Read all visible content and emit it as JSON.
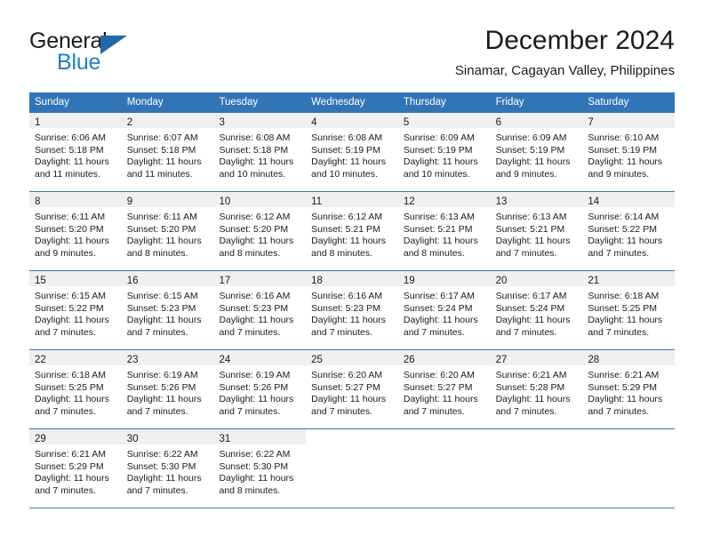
{
  "brand": {
    "name_part1": "General",
    "name_part2": "Blue",
    "triangle_icon": "triangle-logo-icon",
    "accent_color": "#1d7ec8",
    "logo_color": "#2469a8"
  },
  "header": {
    "title": "December 2024",
    "subtitle": "Sinamar, Cagayan Valley, Philippines"
  },
  "calendar": {
    "header_bg_color": "#3275b6",
    "daynum_band_color": "#f0f0f0",
    "weekdays": [
      "Sunday",
      "Monday",
      "Tuesday",
      "Wednesday",
      "Thursday",
      "Friday",
      "Saturday"
    ],
    "weeks": [
      [
        {
          "day": "1",
          "sunrise": "Sunrise: 6:06 AM",
          "sunset": "Sunset: 5:18 PM",
          "daylight_line1": "Daylight: 11 hours",
          "daylight_line2": "and 11 minutes."
        },
        {
          "day": "2",
          "sunrise": "Sunrise: 6:07 AM",
          "sunset": "Sunset: 5:18 PM",
          "daylight_line1": "Daylight: 11 hours",
          "daylight_line2": "and 11 minutes."
        },
        {
          "day": "3",
          "sunrise": "Sunrise: 6:08 AM",
          "sunset": "Sunset: 5:18 PM",
          "daylight_line1": "Daylight: 11 hours",
          "daylight_line2": "and 10 minutes."
        },
        {
          "day": "4",
          "sunrise": "Sunrise: 6:08 AM",
          "sunset": "Sunset: 5:19 PM",
          "daylight_line1": "Daylight: 11 hours",
          "daylight_line2": "and 10 minutes."
        },
        {
          "day": "5",
          "sunrise": "Sunrise: 6:09 AM",
          "sunset": "Sunset: 5:19 PM",
          "daylight_line1": "Daylight: 11 hours",
          "daylight_line2": "and 10 minutes."
        },
        {
          "day": "6",
          "sunrise": "Sunrise: 6:09 AM",
          "sunset": "Sunset: 5:19 PM",
          "daylight_line1": "Daylight: 11 hours",
          "daylight_line2": "and 9 minutes."
        },
        {
          "day": "7",
          "sunrise": "Sunrise: 6:10 AM",
          "sunset": "Sunset: 5:19 PM",
          "daylight_line1": "Daylight: 11 hours",
          "daylight_line2": "and 9 minutes."
        }
      ],
      [
        {
          "day": "8",
          "sunrise": "Sunrise: 6:11 AM",
          "sunset": "Sunset: 5:20 PM",
          "daylight_line1": "Daylight: 11 hours",
          "daylight_line2": "and 9 minutes."
        },
        {
          "day": "9",
          "sunrise": "Sunrise: 6:11 AM",
          "sunset": "Sunset: 5:20 PM",
          "daylight_line1": "Daylight: 11 hours",
          "daylight_line2": "and 8 minutes."
        },
        {
          "day": "10",
          "sunrise": "Sunrise: 6:12 AM",
          "sunset": "Sunset: 5:20 PM",
          "daylight_line1": "Daylight: 11 hours",
          "daylight_line2": "and 8 minutes."
        },
        {
          "day": "11",
          "sunrise": "Sunrise: 6:12 AM",
          "sunset": "Sunset: 5:21 PM",
          "daylight_line1": "Daylight: 11 hours",
          "daylight_line2": "and 8 minutes."
        },
        {
          "day": "12",
          "sunrise": "Sunrise: 6:13 AM",
          "sunset": "Sunset: 5:21 PM",
          "daylight_line1": "Daylight: 11 hours",
          "daylight_line2": "and 8 minutes."
        },
        {
          "day": "13",
          "sunrise": "Sunrise: 6:13 AM",
          "sunset": "Sunset: 5:21 PM",
          "daylight_line1": "Daylight: 11 hours",
          "daylight_line2": "and 7 minutes."
        },
        {
          "day": "14",
          "sunrise": "Sunrise: 6:14 AM",
          "sunset": "Sunset: 5:22 PM",
          "daylight_line1": "Daylight: 11 hours",
          "daylight_line2": "and 7 minutes."
        }
      ],
      [
        {
          "day": "15",
          "sunrise": "Sunrise: 6:15 AM",
          "sunset": "Sunset: 5:22 PM",
          "daylight_line1": "Daylight: 11 hours",
          "daylight_line2": "and 7 minutes."
        },
        {
          "day": "16",
          "sunrise": "Sunrise: 6:15 AM",
          "sunset": "Sunset: 5:23 PM",
          "daylight_line1": "Daylight: 11 hours",
          "daylight_line2": "and 7 minutes."
        },
        {
          "day": "17",
          "sunrise": "Sunrise: 6:16 AM",
          "sunset": "Sunset: 5:23 PM",
          "daylight_line1": "Daylight: 11 hours",
          "daylight_line2": "and 7 minutes."
        },
        {
          "day": "18",
          "sunrise": "Sunrise: 6:16 AM",
          "sunset": "Sunset: 5:23 PM",
          "daylight_line1": "Daylight: 11 hours",
          "daylight_line2": "and 7 minutes."
        },
        {
          "day": "19",
          "sunrise": "Sunrise: 6:17 AM",
          "sunset": "Sunset: 5:24 PM",
          "daylight_line1": "Daylight: 11 hours",
          "daylight_line2": "and 7 minutes."
        },
        {
          "day": "20",
          "sunrise": "Sunrise: 6:17 AM",
          "sunset": "Sunset: 5:24 PM",
          "daylight_line1": "Daylight: 11 hours",
          "daylight_line2": "and 7 minutes."
        },
        {
          "day": "21",
          "sunrise": "Sunrise: 6:18 AM",
          "sunset": "Sunset: 5:25 PM",
          "daylight_line1": "Daylight: 11 hours",
          "daylight_line2": "and 7 minutes."
        }
      ],
      [
        {
          "day": "22",
          "sunrise": "Sunrise: 6:18 AM",
          "sunset": "Sunset: 5:25 PM",
          "daylight_line1": "Daylight: 11 hours",
          "daylight_line2": "and 7 minutes."
        },
        {
          "day": "23",
          "sunrise": "Sunrise: 6:19 AM",
          "sunset": "Sunset: 5:26 PM",
          "daylight_line1": "Daylight: 11 hours",
          "daylight_line2": "and 7 minutes."
        },
        {
          "day": "24",
          "sunrise": "Sunrise: 6:19 AM",
          "sunset": "Sunset: 5:26 PM",
          "daylight_line1": "Daylight: 11 hours",
          "daylight_line2": "and 7 minutes."
        },
        {
          "day": "25",
          "sunrise": "Sunrise: 6:20 AM",
          "sunset": "Sunset: 5:27 PM",
          "daylight_line1": "Daylight: 11 hours",
          "daylight_line2": "and 7 minutes."
        },
        {
          "day": "26",
          "sunrise": "Sunrise: 6:20 AM",
          "sunset": "Sunset: 5:27 PM",
          "daylight_line1": "Daylight: 11 hours",
          "daylight_line2": "and 7 minutes."
        },
        {
          "day": "27",
          "sunrise": "Sunrise: 6:21 AM",
          "sunset": "Sunset: 5:28 PM",
          "daylight_line1": "Daylight: 11 hours",
          "daylight_line2": "and 7 minutes."
        },
        {
          "day": "28",
          "sunrise": "Sunrise: 6:21 AM",
          "sunset": "Sunset: 5:29 PM",
          "daylight_line1": "Daylight: 11 hours",
          "daylight_line2": "and 7 minutes."
        }
      ],
      [
        {
          "day": "29",
          "sunrise": "Sunrise: 6:21 AM",
          "sunset": "Sunset: 5:29 PM",
          "daylight_line1": "Daylight: 11 hours",
          "daylight_line2": "and 7 minutes."
        },
        {
          "day": "30",
          "sunrise": "Sunrise: 6:22 AM",
          "sunset": "Sunset: 5:30 PM",
          "daylight_line1": "Daylight: 11 hours",
          "daylight_line2": "and 7 minutes."
        },
        {
          "day": "31",
          "sunrise": "Sunrise: 6:22 AM",
          "sunset": "Sunset: 5:30 PM",
          "daylight_line1": "Daylight: 11 hours",
          "daylight_line2": "and 8 minutes."
        },
        {
          "day": "",
          "sunrise": "",
          "sunset": "",
          "daylight_line1": "",
          "daylight_line2": ""
        },
        {
          "day": "",
          "sunrise": "",
          "sunset": "",
          "daylight_line1": "",
          "daylight_line2": ""
        },
        {
          "day": "",
          "sunrise": "",
          "sunset": "",
          "daylight_line1": "",
          "daylight_line2": ""
        },
        {
          "day": "",
          "sunrise": "",
          "sunset": "",
          "daylight_line1": "",
          "daylight_line2": ""
        }
      ]
    ]
  }
}
